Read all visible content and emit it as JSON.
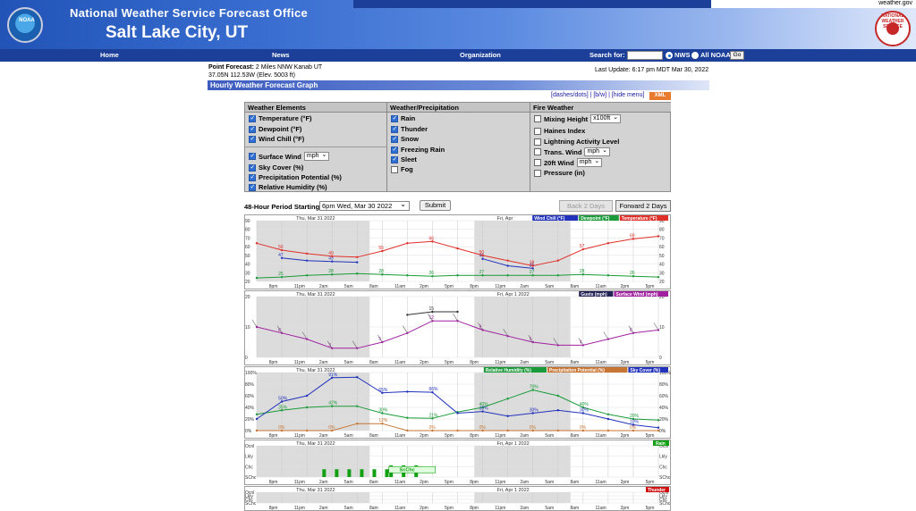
{
  "header": {
    "office_title": "National Weather Service Forecast Office",
    "city_title": "Salt Lake City, UT",
    "noaa_logo_text": "NOAA",
    "nws_logo_text": "NATIONAL WEATHER SERVICE",
    "weather_gov": "weather.gov"
  },
  "nav": {
    "items": [
      "Home",
      "News",
      "Organization"
    ],
    "search_label": "Search for:",
    "radio_nws": "NWS",
    "radio_noaa": "All NOAA",
    "go": "Go"
  },
  "forecast": {
    "point_label": "Point Forecast:",
    "point_value": "2 Miles NNW Kanab UT",
    "coords": "37.05N 112.53W (Elev. 5003 ft)",
    "last_update": "Last Update: 6:17 pm MDT Mar 30, 2022",
    "graph_title": "Hourly Weather Forecast Graph",
    "links": "[dashes/dots] | [b/w] | [hide menu]",
    "xml": "XML"
  },
  "options": {
    "weather_elements": {
      "header": "Weather Elements",
      "items": [
        "Temperature (°F)",
        "Dewpoint (°F)",
        "Wind Chill (°F)",
        "Surface Wind",
        "Sky Cover (%)",
        "Precipitation Potential (%)",
        "Relative Humidity (%)"
      ],
      "wind_unit": "mph"
    },
    "weather_precip": {
      "header": "Weather/Precipitation",
      "items": [
        "Rain",
        "Thunder",
        "Snow",
        "Freezing Rain",
        "Sleet",
        "Fog"
      ]
    },
    "fire_weather": {
      "header": "Fire Weather",
      "items": [
        "Mixing Height",
        "Haines Index",
        "Lightning Activity Level",
        "Trans. Wind",
        "20ft Wind",
        "Pressure (in)"
      ],
      "mixing_unit": "x100ft",
      "trans_unit": "mph",
      "wind20_unit": "mph"
    }
  },
  "period": {
    "label": "48-Hour Period Starting:",
    "value": "6pm Wed, Mar 30 2022",
    "submit": "Submit",
    "back": "Back 2 Days",
    "forward": "Forward 2 Days"
  },
  "graphs": {
    "day1": "Thu, Mar 31 2022",
    "day2": "Fri, Apr 1 2022",
    "day2_short": "Fri, Apr",
    "time_ticks": [
      "8pm",
      "11pm",
      "2am",
      "5am",
      "8am",
      "11am",
      "2pm",
      "5pm",
      "8pm",
      "11pm",
      "2am",
      "5am",
      "8am",
      "11am",
      "2pm",
      "5pm"
    ],
    "temp_legend": [
      "Wind Chill (°F)",
      "Dewpoint (°F)",
      "Temperature (°F)"
    ],
    "temp_axis": [
      "90",
      "80",
      "70",
      "60",
      "50",
      "40",
      "30",
      "20"
    ],
    "wind_legend": [
      "Gusts (mph)",
      "Surface Wind (mph)"
    ],
    "wind_axis": [
      "20",
      "10",
      "0"
    ],
    "rh_legend": [
      "Relative Humidity (%)",
      "Precipitation Potential (%)",
      "Sky Cover (%)"
    ],
    "rh_axis": [
      "100%",
      "80%",
      "60%",
      "40%",
      "20%",
      "0%"
    ],
    "rain_legend": "Rain",
    "rain_label": "ScChc",
    "precip_axis": [
      "Ocnl",
      "Lkly",
      "Chc",
      "SChc"
    ],
    "thunder_legend": "Thunder",
    "colors": {
      "temperature": "#e0302a",
      "dewpoint": "#1a9a38",
      "windchill": "#2233bb",
      "wind": "#a020a0",
      "gust": "#333333",
      "sky": "#2233bb",
      "precip": "#c87533",
      "rh": "#1a9a38",
      "rain": "#11a011"
    }
  },
  "chart_data": [
    {
      "type": "line",
      "title": "Temperature / Dewpoint / Wind Chill",
      "ylim": [
        20,
        90
      ],
      "x_hours_from_6pm_wed": [
        0,
        3,
        6,
        9,
        12,
        15,
        18,
        21,
        24,
        27,
        30,
        33,
        36,
        39,
        42,
        45,
        48
      ],
      "series": [
        {
          "name": "Temperature (°F)",
          "values": [
            64,
            56,
            52,
            49,
            48,
            55,
            64,
            66,
            58,
            50,
            44,
            38,
            44,
            57,
            64,
            69,
            72
          ]
        },
        {
          "name": "Dewpoint (°F)",
          "values": [
            24,
            25,
            27,
            28,
            29,
            28,
            27,
            26,
            27,
            27,
            27,
            27,
            27,
            28,
            27,
            26,
            25
          ]
        },
        {
          "name": "Wind Chill (°F)",
          "values": [
            null,
            47,
            44,
            43,
            42,
            null,
            null,
            null,
            null,
            46,
            38,
            35,
            null,
            null,
            null,
            null,
            null
          ]
        }
      ]
    },
    {
      "type": "line",
      "title": "Wind",
      "ylim": [
        0,
        20
      ],
      "x_hours_from_6pm_wed": [
        0,
        3,
        6,
        9,
        12,
        15,
        18,
        21,
        24,
        27,
        30,
        33,
        36,
        39,
        42,
        45,
        48
      ],
      "series": [
        {
          "name": "Surface Wind (mph)",
          "values": [
            10,
            8,
            6,
            3,
            3,
            5,
            8,
            12,
            12,
            9,
            7,
            5,
            4,
            4,
            6,
            8,
            9
          ]
        },
        {
          "name": "Gusts (mph)",
          "values": [
            null,
            null,
            null,
            null,
            null,
            null,
            14,
            15,
            15,
            null,
            null,
            null,
            null,
            null,
            null,
            null,
            null
          ]
        }
      ]
    },
    {
      "type": "line",
      "title": "Relative Humidity / Precipitation / Sky",
      "ylim": [
        0,
        100
      ],
      "x_hours_from_6pm_wed": [
        0,
        3,
        6,
        9,
        12,
        15,
        18,
        21,
        24,
        27,
        30,
        33,
        36,
        39,
        42,
        45,
        48
      ],
      "series": [
        {
          "name": "Relative Humidity (%)",
          "values": [
            28,
            35,
            40,
            42,
            42,
            30,
            22,
            21,
            32,
            40,
            55,
            70,
            60,
            40,
            28,
            20,
            18
          ]
        },
        {
          "name": "Precipitation Potential (%)",
          "values": [
            0,
            0,
            0,
            0,
            12,
            12,
            0,
            0,
            0,
            0,
            0,
            0,
            0,
            0,
            0,
            0,
            0
          ]
        },
        {
          "name": "Sky Cover (%)",
          "values": [
            20,
            50,
            60,
            91,
            92,
            65,
            67,
            66,
            30,
            33,
            25,
            30,
            35,
            30,
            20,
            10,
            5
          ]
        }
      ]
    }
  ]
}
